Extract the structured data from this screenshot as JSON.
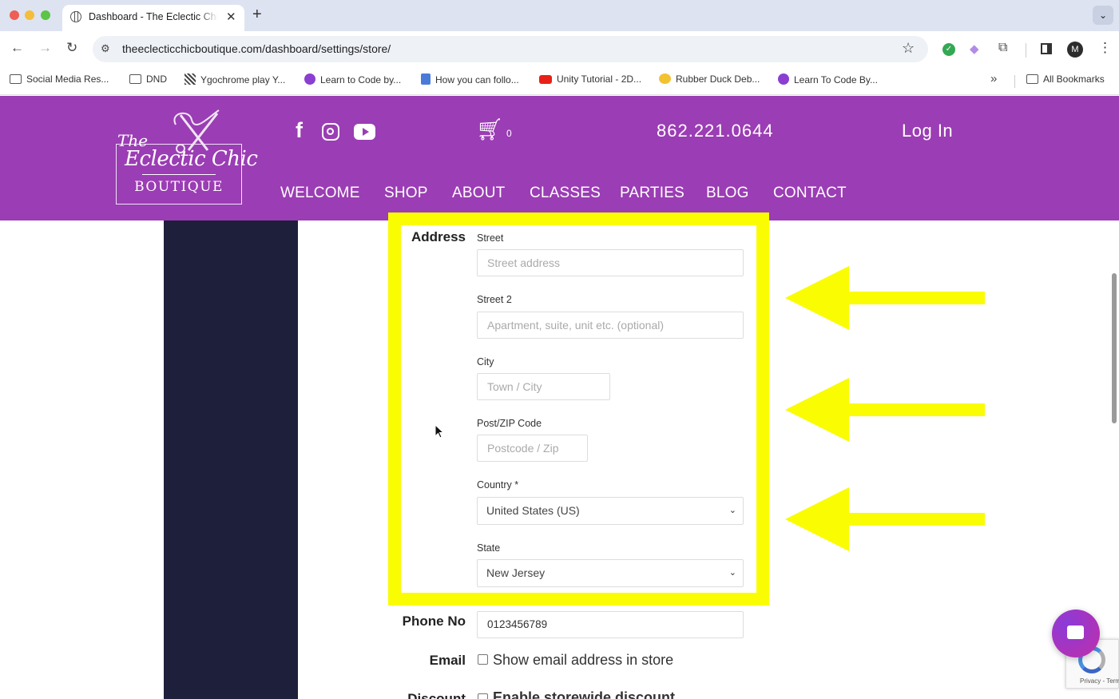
{
  "browser": {
    "tab_title": "Dashboard - The Eclectic Chic Boutique",
    "new_tab": "+",
    "close": "✕",
    "url": "theeclecticchicboutique.com/dashboard/settings/store/",
    "profile_initial": "M",
    "bookmarks": [
      {
        "label": "Social Media Res...",
        "icon": "folder-icon"
      },
      {
        "label": "DND",
        "icon": "folder-icon"
      },
      {
        "label": "Ygochrome play Y...",
        "icon": "site-icon"
      },
      {
        "label": "Learn to Code by...",
        "icon": "freecodecamp-icon"
      },
      {
        "label": "How you can follo...",
        "icon": "doc-icon"
      },
      {
        "label": "Unity Tutorial - 2D...",
        "icon": "youtube-icon"
      },
      {
        "label": "Rubber Duck Deb...",
        "icon": "duck-icon"
      },
      {
        "label": "Learn To Code By...",
        "icon": "freecodecamp-icon"
      }
    ],
    "more_bookmarks": "»",
    "all_bookmarks": "All Bookmarks"
  },
  "site": {
    "logo_the": "The",
    "logo_name": "Eclectic Chic",
    "logo_sub": "BOUTIQUE",
    "cart_count": "0",
    "phone": "862.221.0644",
    "login": "Log In",
    "nav": [
      "WELCOME",
      "SHOP",
      "ABOUT",
      "CLASSES",
      "PARTIES",
      "BLOG",
      "CONTACT"
    ]
  },
  "form": {
    "address_label": "Address",
    "street_label": "Street",
    "street_placeholder": "Street address",
    "street2_label": "Street 2",
    "street2_placeholder": "Apartment, suite, unit etc. (optional)",
    "city_label": "City",
    "city_placeholder": "Town / City",
    "zip_label": "Post/ZIP Code",
    "zip_placeholder": "Postcode / Zip",
    "country_label": "Country *",
    "country_value": "United States (US)",
    "state_label": "State",
    "state_value": "New Jersey",
    "phone_label": "Phone No",
    "phone_value": "0123456789",
    "email_label": "Email",
    "email_checkbox": "Show email address in store",
    "discount_label": "Discount",
    "discount_checkbox": "Enable storewide discount"
  },
  "recaptcha_text": "Privacy - Terms",
  "colors": {
    "header_purple": "#9b3db4",
    "highlight_yellow": "#fafc02",
    "sidebar_navy": "#1e1f3a"
  }
}
